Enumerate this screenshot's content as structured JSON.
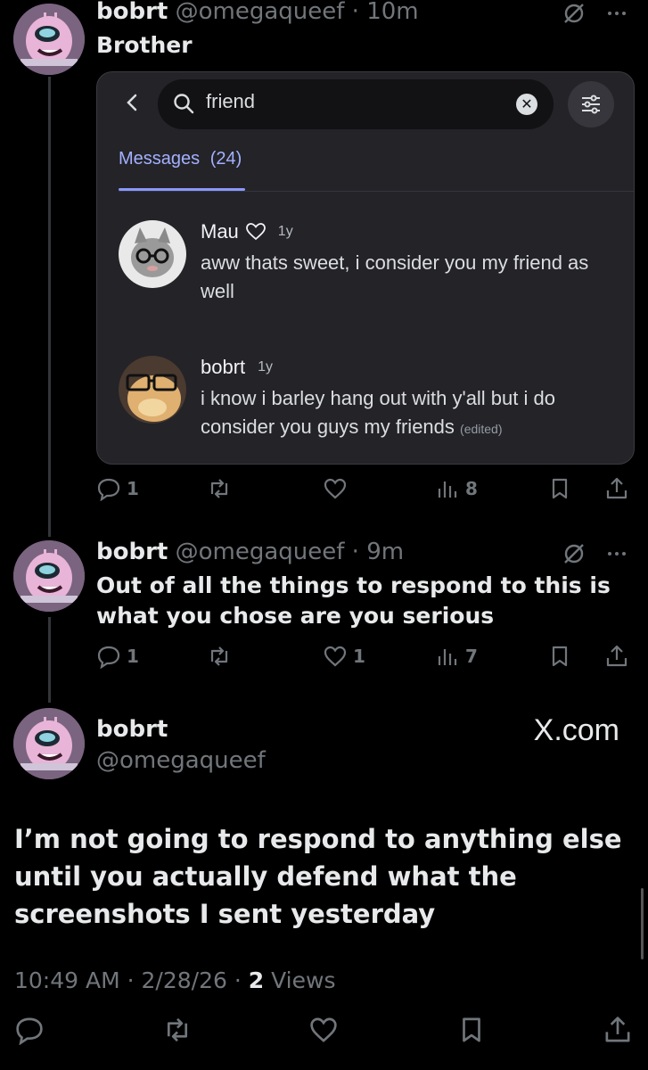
{
  "colors": {
    "background": "#000000",
    "muted": "#71767b",
    "text": "#e7e9ea",
    "discord_accent": "#a3b1ff"
  },
  "tweet1": {
    "name": "bobrt",
    "handle": "@omegaqueef",
    "dot": "·",
    "time": "10m",
    "text": "Brother",
    "replies": "1",
    "retweets": "",
    "likes": "",
    "views": "8"
  },
  "embed": {
    "search_value": "friend",
    "tab": "Messages",
    "tab_count": "(24)",
    "messages": [
      {
        "author": "Mau",
        "time": "1y",
        "text": "aww thats sweet, i consider you my friend as well",
        "edited": ""
      },
      {
        "author": "bobrt",
        "time": "1y",
        "text": "i know i barley hang out with y'all but i do consider you guys my friends",
        "edited": "(edited)"
      }
    ]
  },
  "tweet2": {
    "name": "bobrt",
    "handle": "@omegaqueef",
    "dot": "·",
    "time": "9m",
    "text": "Out of all the things to respond to this is what you chose are you serious",
    "replies": "1",
    "retweets": "",
    "likes": "1",
    "views": "7"
  },
  "focused": {
    "name": "bobrt",
    "handle": "@omegaqueef",
    "brand": "X.com",
    "text": "I’m not going to respond to anything else until you actually defend what the screenshots I sent yesterday",
    "time": "10:49 AM",
    "date": "2/28/26",
    "sep": "·",
    "views_count": "2",
    "views_label": "Views"
  },
  "icons": [
    "reply-icon",
    "retweet-icon",
    "like-icon",
    "views-icon",
    "bookmark-icon",
    "share-icon",
    "grok-icon",
    "more-icon",
    "search-icon",
    "back-icon",
    "filter-icon",
    "clear-icon"
  ]
}
